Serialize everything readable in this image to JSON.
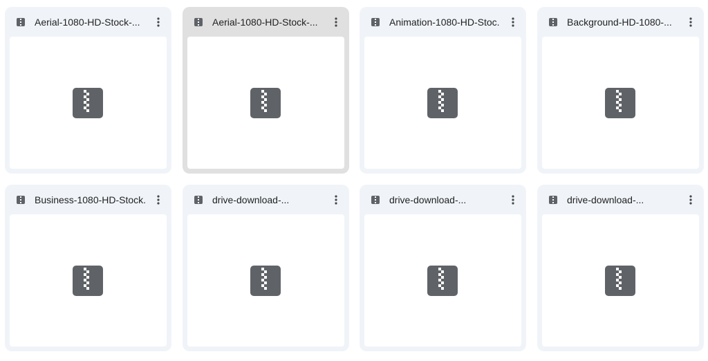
{
  "files": [
    {
      "name": "Aerial-1080-HD-Stock-...",
      "type_icon": "zip-file-icon",
      "selected": false
    },
    {
      "name": "Aerial-1080-HD-Stock-...",
      "type_icon": "zip-file-icon",
      "selected": true
    },
    {
      "name": "Animation-1080-HD-Stoc...",
      "type_icon": "zip-file-icon",
      "selected": false
    },
    {
      "name": "Background-HD-1080-...",
      "type_icon": "zip-file-icon",
      "selected": false
    },
    {
      "name": "Business-1080-HD-Stock...",
      "type_icon": "zip-file-icon",
      "selected": false
    },
    {
      "name": "drive-download-...",
      "type_icon": "zip-file-icon",
      "selected": false
    },
    {
      "name": "drive-download-...",
      "type_icon": "zip-file-icon",
      "selected": false
    },
    {
      "name": "drive-download-...",
      "type_icon": "zip-file-icon",
      "selected": false
    }
  ],
  "colors": {
    "card_bg": "#f0f4f9",
    "card_selected_bg": "#e0e0e0",
    "icon_gray": "#5f6368",
    "text": "#1f1f1f"
  }
}
